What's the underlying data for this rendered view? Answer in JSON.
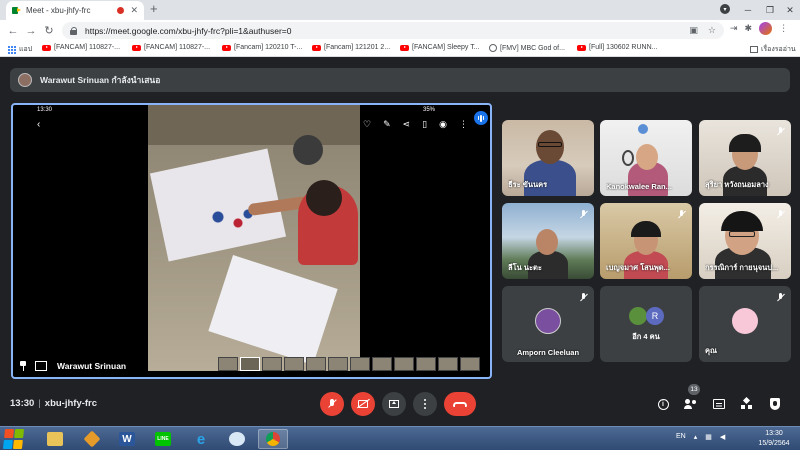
{
  "browser": {
    "tab_title": "Meet - xbu-jhfy-frc",
    "tab_close": "✕",
    "new_tab": "+",
    "url": "https://meet.google.com/xbu-jhfy-frc?pli=1&authuser=0",
    "back": "←",
    "forward": "→",
    "reload": "↻",
    "win_min": "─",
    "win_max": "❐",
    "win_close": "✕",
    "menu": "⋮"
  },
  "bookmarks": {
    "apps": "แอป",
    "items": [
      "[FANCAM] 110827-...",
      "[FANCAM] 110827-...",
      "[Fancam] 120210 T-...",
      "[Fancam] 121201 2...",
      "[FANCAM] Sleepy T...",
      "[FMV] MBC God of...",
      "[Full] 130602 RUNN..."
    ],
    "reading_list": "เรื่องรออ่าน"
  },
  "meet": {
    "presenting_banner": "Warawut Srinuan กำลังนำเสนอ",
    "presenter_name": "Warawut Srinuan",
    "phone_time": "13:30",
    "phone_battery": "35%",
    "time": "13:30",
    "code": "xbu-jhfy-frc",
    "people_count": "13",
    "participants": [
      {
        "name": "ธีระ ขันนคร"
      },
      {
        "name": "Kanokwalee Ran..."
      },
      {
        "name": "สุริยา หวังถนอมลาง"
      },
      {
        "name": "ลีโน นะตะ"
      },
      {
        "name": "เบญจมาศ โสนพุด..."
      },
      {
        "name": "กรรณิการ์ กายนุจนป..."
      },
      {
        "name": "Amporn Cleeluan"
      },
      {
        "name": "อีก 4 คน"
      },
      {
        "name": "คุณ"
      }
    ],
    "more_initial": "R"
  },
  "taskbar": {
    "lang": "EN",
    "clock_time": "13:30",
    "clock_date": "15/9/2564"
  },
  "colors": {
    "accent": "#8ab4f8",
    "danger": "#ea4335",
    "surface": "#3c4043",
    "background": "#202124"
  }
}
